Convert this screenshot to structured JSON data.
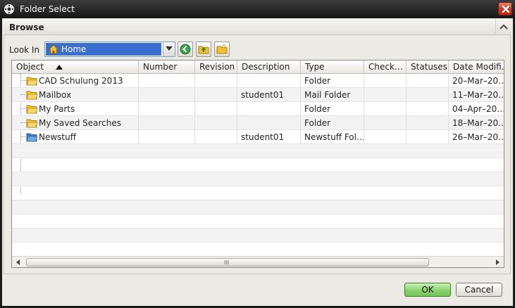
{
  "window": {
    "title": "Folder Select",
    "icon": "gear-icon"
  },
  "section": {
    "title": "Browse"
  },
  "lookin": {
    "label": "Look In",
    "value": "Home",
    "toolbar_icons": [
      "back-icon",
      "folder-up-icon",
      "new-folder-icon"
    ]
  },
  "table": {
    "columns": [
      "Object",
      "Number",
      "Revision",
      "Description",
      "Type",
      "Check…",
      "Statuses",
      "Date Modifi…"
    ],
    "sort_column": "Object",
    "sort_direction": "ascending",
    "rows": [
      {
        "object": "CAD Schulung 2013",
        "number": "",
        "revision": "",
        "description": "",
        "type": "Folder",
        "check": "",
        "statuses": "",
        "date": "20–Mar–20…",
        "icon": "folder-icon"
      },
      {
        "object": "Mailbox",
        "number": "",
        "revision": "",
        "description": "student01",
        "type": "Mail Folder",
        "check": "",
        "statuses": "",
        "date": "11–Mar–20…",
        "icon": "folder-icon"
      },
      {
        "object": "My Parts",
        "number": "",
        "revision": "",
        "description": "",
        "type": "Folder",
        "check": "",
        "statuses": "",
        "date": "04–Apr–20…",
        "icon": "folder-icon"
      },
      {
        "object": "My Saved Searches",
        "number": "",
        "revision": "",
        "description": "",
        "type": "Folder",
        "check": "",
        "statuses": "",
        "date": "18–Mar–20…",
        "icon": "folder-icon"
      },
      {
        "object": "Newstuff",
        "number": "",
        "revision": "",
        "description": "student01",
        "type": "Newstuff Fol…",
        "check": "",
        "statuses": "",
        "date": "26–Mar–20…",
        "icon": "newstuff-folder-icon"
      }
    ]
  },
  "scrollbar": {
    "grip": "III"
  },
  "buttons": {
    "ok": "OK",
    "cancel": "Cancel"
  },
  "colors": {
    "selection": "#3a6fcf",
    "ok_button": "#86d26a",
    "close_button": "#c8361d",
    "folder": "#f2c12e"
  }
}
